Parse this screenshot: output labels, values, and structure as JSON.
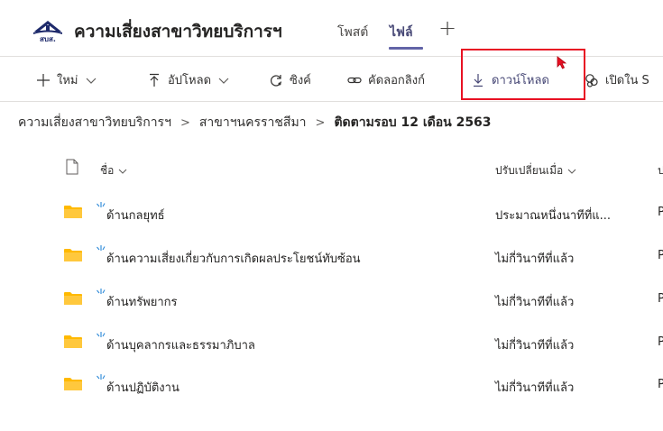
{
  "header": {
    "channel_title": "ความเสี่ยงสาขาวิทยบริการฯ",
    "tabs": [
      {
        "label": "โพสต์",
        "active": false
      },
      {
        "label": "ไฟล์",
        "active": true
      }
    ],
    "add_tab": "+",
    "logo_text": "สบส."
  },
  "toolbar": {
    "new_label": "ใหม่",
    "upload_label": "อัปโหลด",
    "sync_label": "ซิงค์",
    "copy_link_label": "คัดลอกลิงก์",
    "download_label": "ดาวน์โหลด",
    "open_in_label": "เปิดใน S"
  },
  "breadcrumb": [
    "ความเสี่ยงสาขาวิทยบริการฯ",
    "สาขาฯนครราชสีมา",
    "ติดตามรอบ 12 เดือน 2563"
  ],
  "table": {
    "columns": {
      "name": "ชื่อ",
      "modified": "ปรับเปลี่ยนเมื่อ",
      "modified_by": "ป"
    },
    "rows": [
      {
        "name": "ด้านกลยุทธ์",
        "modified": "ประมาณหนึ่งนาทีที่แ...",
        "modified_by": "P"
      },
      {
        "name": "ด้านความเสี่ยงเกี่ยวกับการเกิดผลประโยชน์ทับซ้อน",
        "modified": "ไม่กี่วินาทีที่แล้ว",
        "modified_by": "P"
      },
      {
        "name": "ด้านทรัพยากร",
        "modified": "ไม่กี่วินาทีที่แล้ว",
        "modified_by": "P"
      },
      {
        "name": "ด้านบุคลากรและธรรมาภิบาล",
        "modified": "ไม่กี่วินาทีที่แล้ว",
        "modified_by": "P"
      },
      {
        "name": "ด้านปฏิบัติงาน",
        "modified": "ไม่กี่วินาทีที่แล้ว",
        "modified_by": "P"
      }
    ]
  },
  "colors": {
    "accent": "#6264a7",
    "folder": "#ffb900",
    "highlight": "#e81123",
    "new_mark": "#2b88d8"
  }
}
